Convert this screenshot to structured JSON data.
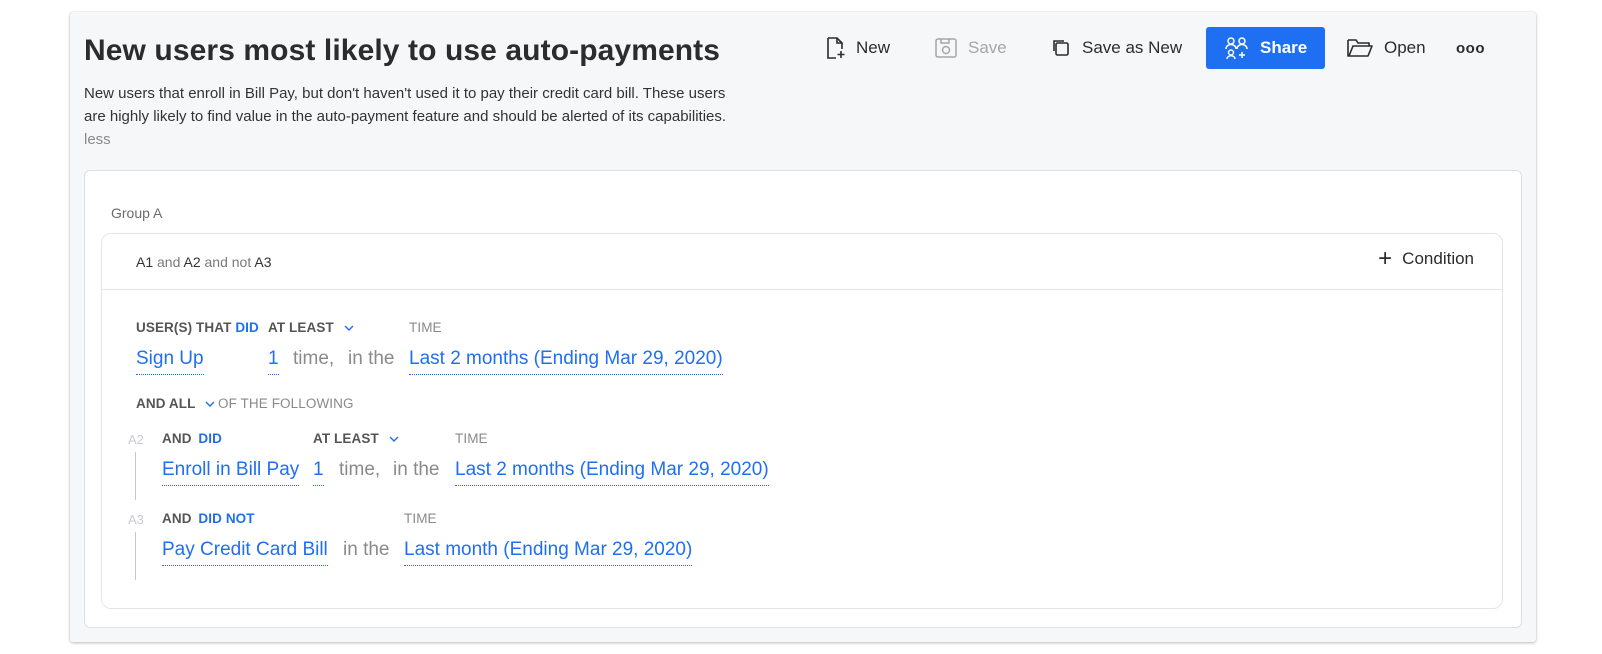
{
  "header": {
    "title": "New users most likely to use auto-payments",
    "description": "New users that enroll in Bill Pay, but don't haven't used it to pay their credit card bill. These users are highly likely to find value in the auto-payment feature and should be alerted of its capabilities.",
    "less_link": "less"
  },
  "toolbar": {
    "new_label": "New",
    "save_label": "Save",
    "save_as_new_label": "Save as New",
    "share_label": "Share",
    "open_label": "Open",
    "more_label": "ooo"
  },
  "colors": {
    "accent": "#1f6ff2",
    "card_bg": "#f6f7f9"
  },
  "group": {
    "label": "Group A",
    "logic": {
      "a1": "A1",
      "and1": "and",
      "a2": "A2",
      "and_not": "and not",
      "a3": "A3"
    },
    "add_condition_label": "Condition",
    "main_condition": {
      "users_that": "USER(S) THAT",
      "did": "DID",
      "at_least": "AT LEAST",
      "time_header": "TIME",
      "event": "Sign Up",
      "count": "1",
      "time_word": "time,",
      "in_the": "in the",
      "range": "Last 2 months (Ending Mar 29, 2020)"
    },
    "and_all": {
      "and_all": "AND ALL",
      "of_following": "OF THE FOLLOWING"
    },
    "conditions": [
      {
        "id": "A2",
        "and": "AND",
        "did": "DID",
        "at_least": "AT LEAST",
        "time_header": "TIME",
        "event": "Enroll in Bill Pay",
        "count": "1",
        "time_word": "time,",
        "in_the": "in the",
        "range": "Last 2 months (Ending Mar 29, 2020)"
      },
      {
        "id": "A3",
        "and": "AND",
        "did": "DID NOT",
        "time_header": "TIME",
        "event": "Pay Credit Card Bill",
        "in_the": "in the",
        "range": "Last month (Ending Mar 29, 2020)"
      }
    ]
  }
}
